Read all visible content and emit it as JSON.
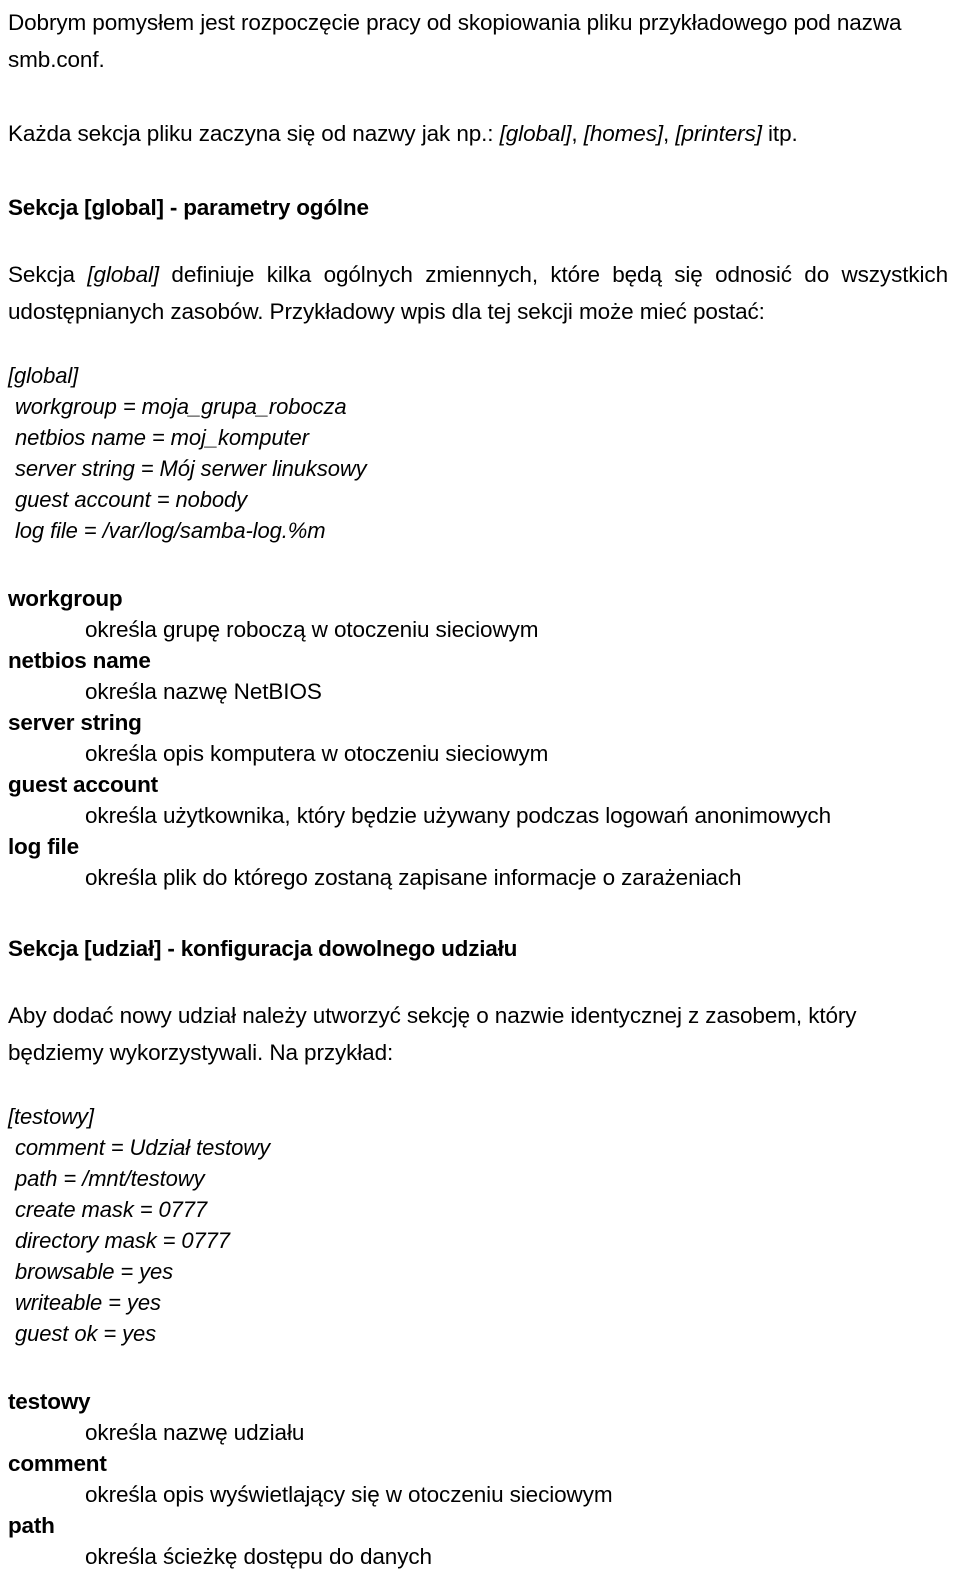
{
  "document": {
    "intro": {
      "paragraph_1": "Dobrym pomysłem jest rozpoczęcie pracy od skopiowania pliku przykładowego pod nazwa smb.conf.",
      "paragraph_2_pre": "Każda sekcja pliku zaczyna się od nazwy jak np.: ",
      "paragraph_2_italic_1": "[global]",
      "paragraph_2_sep_1": ", ",
      "paragraph_2_italic_2": "[homes]",
      "paragraph_2_sep_2": ", ",
      "paragraph_2_italic_3": "[printers]",
      "paragraph_2_post": " itp."
    },
    "section_global": {
      "heading": "Sekcja [global] - parametry ogólne",
      "body_pre": "Sekcja ",
      "body_italic": "[global]",
      "body_post": " definiuje kilka ogólnych zmiennych, które będą się odnosić do wszystkich udostępnianych zasobów. Przykładowy wpis dla tej sekcji może mieć postać:",
      "code_lines": [
        "[global]",
        "workgroup = moja_grupa_robocza",
        "netbios name = moj_komputer",
        "server string = Mój serwer linuksowy",
        "guest account = nobody",
        "log file = /var/log/samba-log.%m"
      ],
      "definitions": [
        {
          "term": "workgroup",
          "desc": "określa grupę roboczą w otoczeniu sieciowym"
        },
        {
          "term": "netbios name",
          "desc": "określa nazwę NetBIOS"
        },
        {
          "term": "server string",
          "desc": "określa opis komputera w otoczeniu sieciowym"
        },
        {
          "term": "guest account",
          "desc": "określa użytkownika, który będzie używany podczas logowań anonimowych"
        },
        {
          "term": "log file",
          "desc": "określa plik do którego zostaną zapisane informacje o zarażeniach"
        }
      ]
    },
    "section_share": {
      "heading": "Sekcja [udział] - konfiguracja dowolnego udziału",
      "body": "Aby dodać nowy udział należy utworzyć sekcję o nazwie identycznej z zasobem, który będziemy wykorzystywali. Na przykład:",
      "code_lines": [
        "[testowy]",
        "comment = Udział testowy",
        "path = /mnt/testowy",
        "create mask = 0777",
        "directory mask = 0777",
        "browsable = yes",
        "writeable = yes",
        "guest ok = yes"
      ],
      "definitions": [
        {
          "term": "testowy",
          "desc": "określa nazwę udziału"
        },
        {
          "term": "comment",
          "desc": "określa opis wyświetlający się w otoczeniu sieciowym"
        },
        {
          "term": "path",
          "desc": "określa ścieżkę dostępu do danych"
        }
      ]
    }
  }
}
